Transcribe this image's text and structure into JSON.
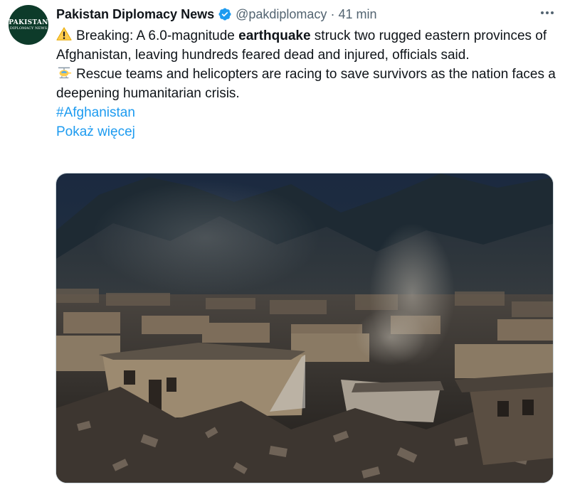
{
  "tweet": {
    "author": {
      "name": "Pakistan Diplomacy News",
      "handle": "@pakdiplomacy",
      "avatar_line1": "PAKISTAN",
      "avatar_line2": "DIPLOMACY NEWS",
      "verified_icon": "verified-badge-icon"
    },
    "separator": "·",
    "time": "41 min",
    "more_icon": "more-horizontal-icon",
    "text": {
      "line1_emoji": "warning-icon",
      "line1_prefix": "Breaking: A 6.0-magnitude ",
      "line1_bold": "earthquake",
      "line1_suffix": " struck two rugged eastern provinces of Afghanistan, leaving hundreds feared dead and injured, officials said.",
      "line2_emoji": "helicopter-icon",
      "line2": "Rescue teams and helicopters are racing to save survivors as the nation faces a deepening humanitarian crisis."
    },
    "hashtag": "#Afghanistan",
    "show_more": "Pokaż więcej",
    "media": {
      "description_icon": "photo-earthquake-ruins",
      "alt": ""
    },
    "colors": {
      "link": "#1d9bf0",
      "secondary_text": "#536471",
      "primary_text": "#0f1419",
      "verified": "#1d9bf0"
    }
  }
}
